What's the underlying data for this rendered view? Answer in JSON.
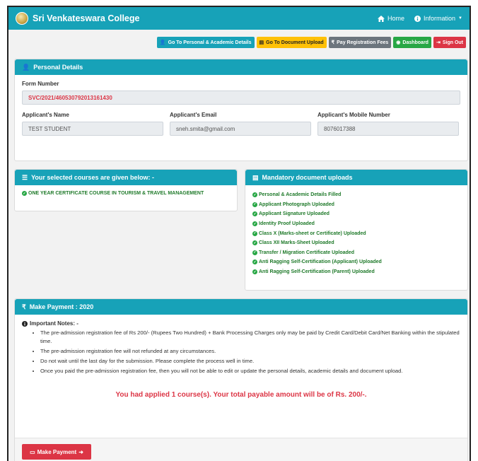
{
  "navbar": {
    "brand": "Sri Venkateswara College",
    "home": "Home",
    "information": "Information"
  },
  "toolbar": {
    "personal_academic": "Go To Personal & Academic Details",
    "document_upload": "Go To Document Upload",
    "pay_fees": "Pay Registration Fees",
    "dashboard": "Dashboard",
    "sign_out": "Sign Out"
  },
  "personal": {
    "title": "Personal Details",
    "form_number_label": "Form Number",
    "form_number": "SVC/2021/460530792013161430",
    "name_label": "Applicant's Name",
    "name": "TEST STUDENT",
    "email_label": "Applicant's Email",
    "email": "sneh.smita@gmail.com",
    "mobile_label": "Applicant's Mobile Number",
    "mobile": "8076017388"
  },
  "courses": {
    "title": "Your selected courses are given below: -",
    "items": [
      "ONE YEAR CERTIFICATE COURSE IN TOURISM & TRAVEL MANAGEMENT"
    ]
  },
  "documents": {
    "title": "Mandatory document uploads",
    "items": [
      "Personal & Academic Details Filled",
      "Applicant Photograph Uploaded",
      "Applicant Signature Uploaded",
      "Identity Proof Uploaded",
      "Class X (Marks-sheet or Certificate) Uploaded",
      "Class XII Marks-Sheet Uploaded",
      "Transfer / Migration Certificate Uploaded",
      "Anti Ragging Self-Certification (Applicant) Uploaded",
      "Anti Ragging Self-Certification (Parent) Uploaded"
    ]
  },
  "payment": {
    "title": "Make Payment : 2020",
    "notes_heading": "Important Notes: -",
    "notes": [
      "The pre-admission registration fee of Rs 200/- (Rupees Two Hundred) + Bank Processing Charges only may be paid by Credit Card/Debit Card/Net Banking within the stipulated time.",
      "The pre-admission registration fee will not refunded at any circumstances.",
      "Do not wait until the last day for the submission. Please complete the process well in time.",
      "Once you paid the pre-admission registration fee, then you will not be able to edit or update the personal details, academic details and document upload."
    ],
    "summary": "You had applied 1 course(s). Your total payable amount will be of Rs. 200/-.",
    "button": "Make Payment"
  },
  "colors": {
    "primary": "#17a2b8",
    "danger": "#dc3545",
    "success": "#28a745",
    "warning": "#ffc107",
    "secondary": "#6c757d"
  }
}
